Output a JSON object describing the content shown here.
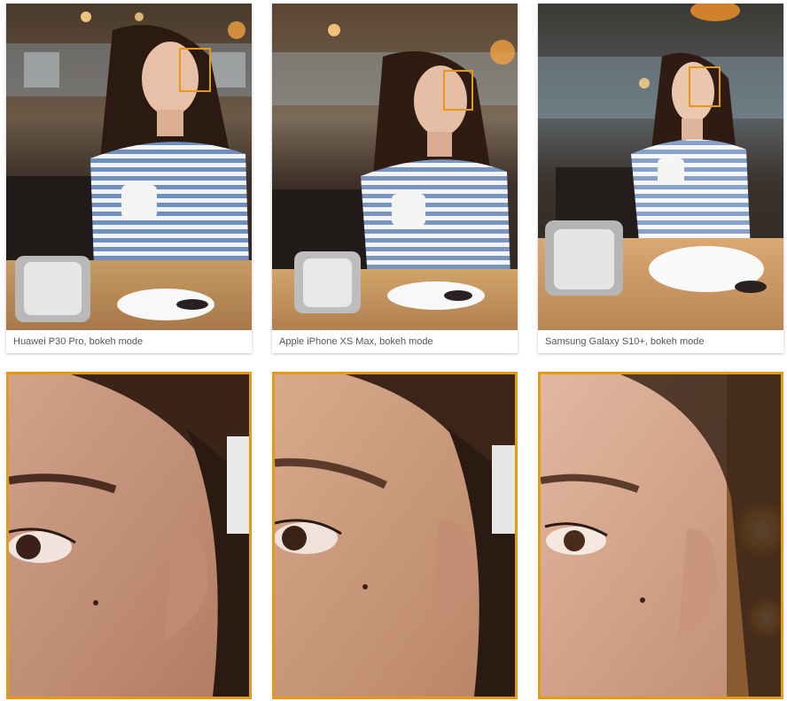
{
  "accent_color": "#e39a17",
  "comparison": {
    "phones": [
      {
        "caption": "Huawei P30 Pro, bokeh mode"
      },
      {
        "caption": "Apple iPhone XS Max, bokeh mode"
      },
      {
        "caption": "Samsung Galaxy S10+, bokeh mode"
      }
    ]
  }
}
